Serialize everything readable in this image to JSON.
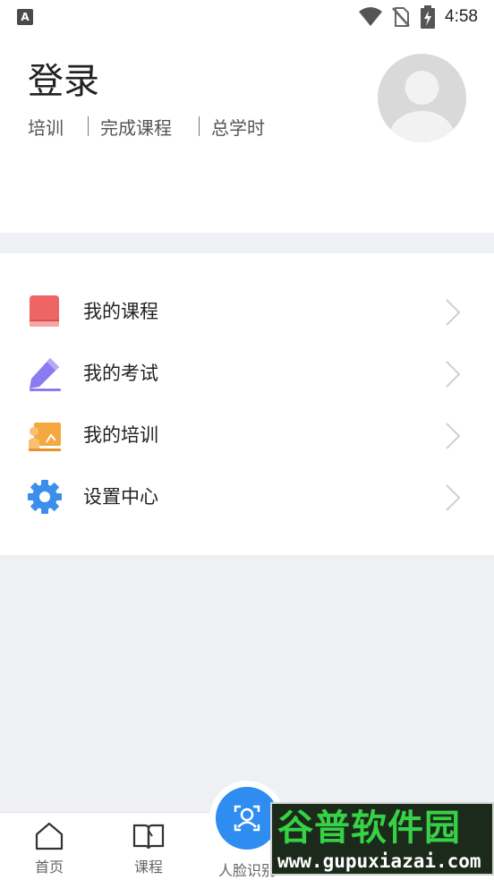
{
  "status_bar": {
    "notification_badge": "A",
    "time": "4:58",
    "icons": [
      "wifi-icon",
      "no-sim-icon",
      "battery-charging-icon"
    ]
  },
  "profile": {
    "title": "登录",
    "stats": [
      "培训",
      "完成课程",
      "总学时"
    ],
    "avatar_icon": "default-avatar-icon"
  },
  "menu": {
    "items": [
      {
        "label": "我的课程",
        "icon": "book-icon",
        "color": "#ef6565"
      },
      {
        "label": "我的考试",
        "icon": "pencil-icon",
        "color": "#8b7bf0"
      },
      {
        "label": "我的培训",
        "icon": "training-board-icon",
        "color": "#f5a742"
      },
      {
        "label": "设置中心",
        "icon": "gear-icon",
        "color": "#3b8eea"
      }
    ]
  },
  "tabbar": {
    "items": [
      {
        "label": "首页",
        "icon": "home-icon"
      },
      {
        "label": "课程",
        "icon": "open-book-icon"
      },
      {
        "label": "人脸识别",
        "icon": "face-recognition-icon"
      }
    ],
    "accent": "#2f8cf0"
  },
  "watermark": {
    "line1": "谷普软件园",
    "line2": "www.gupuxiazai.com"
  }
}
